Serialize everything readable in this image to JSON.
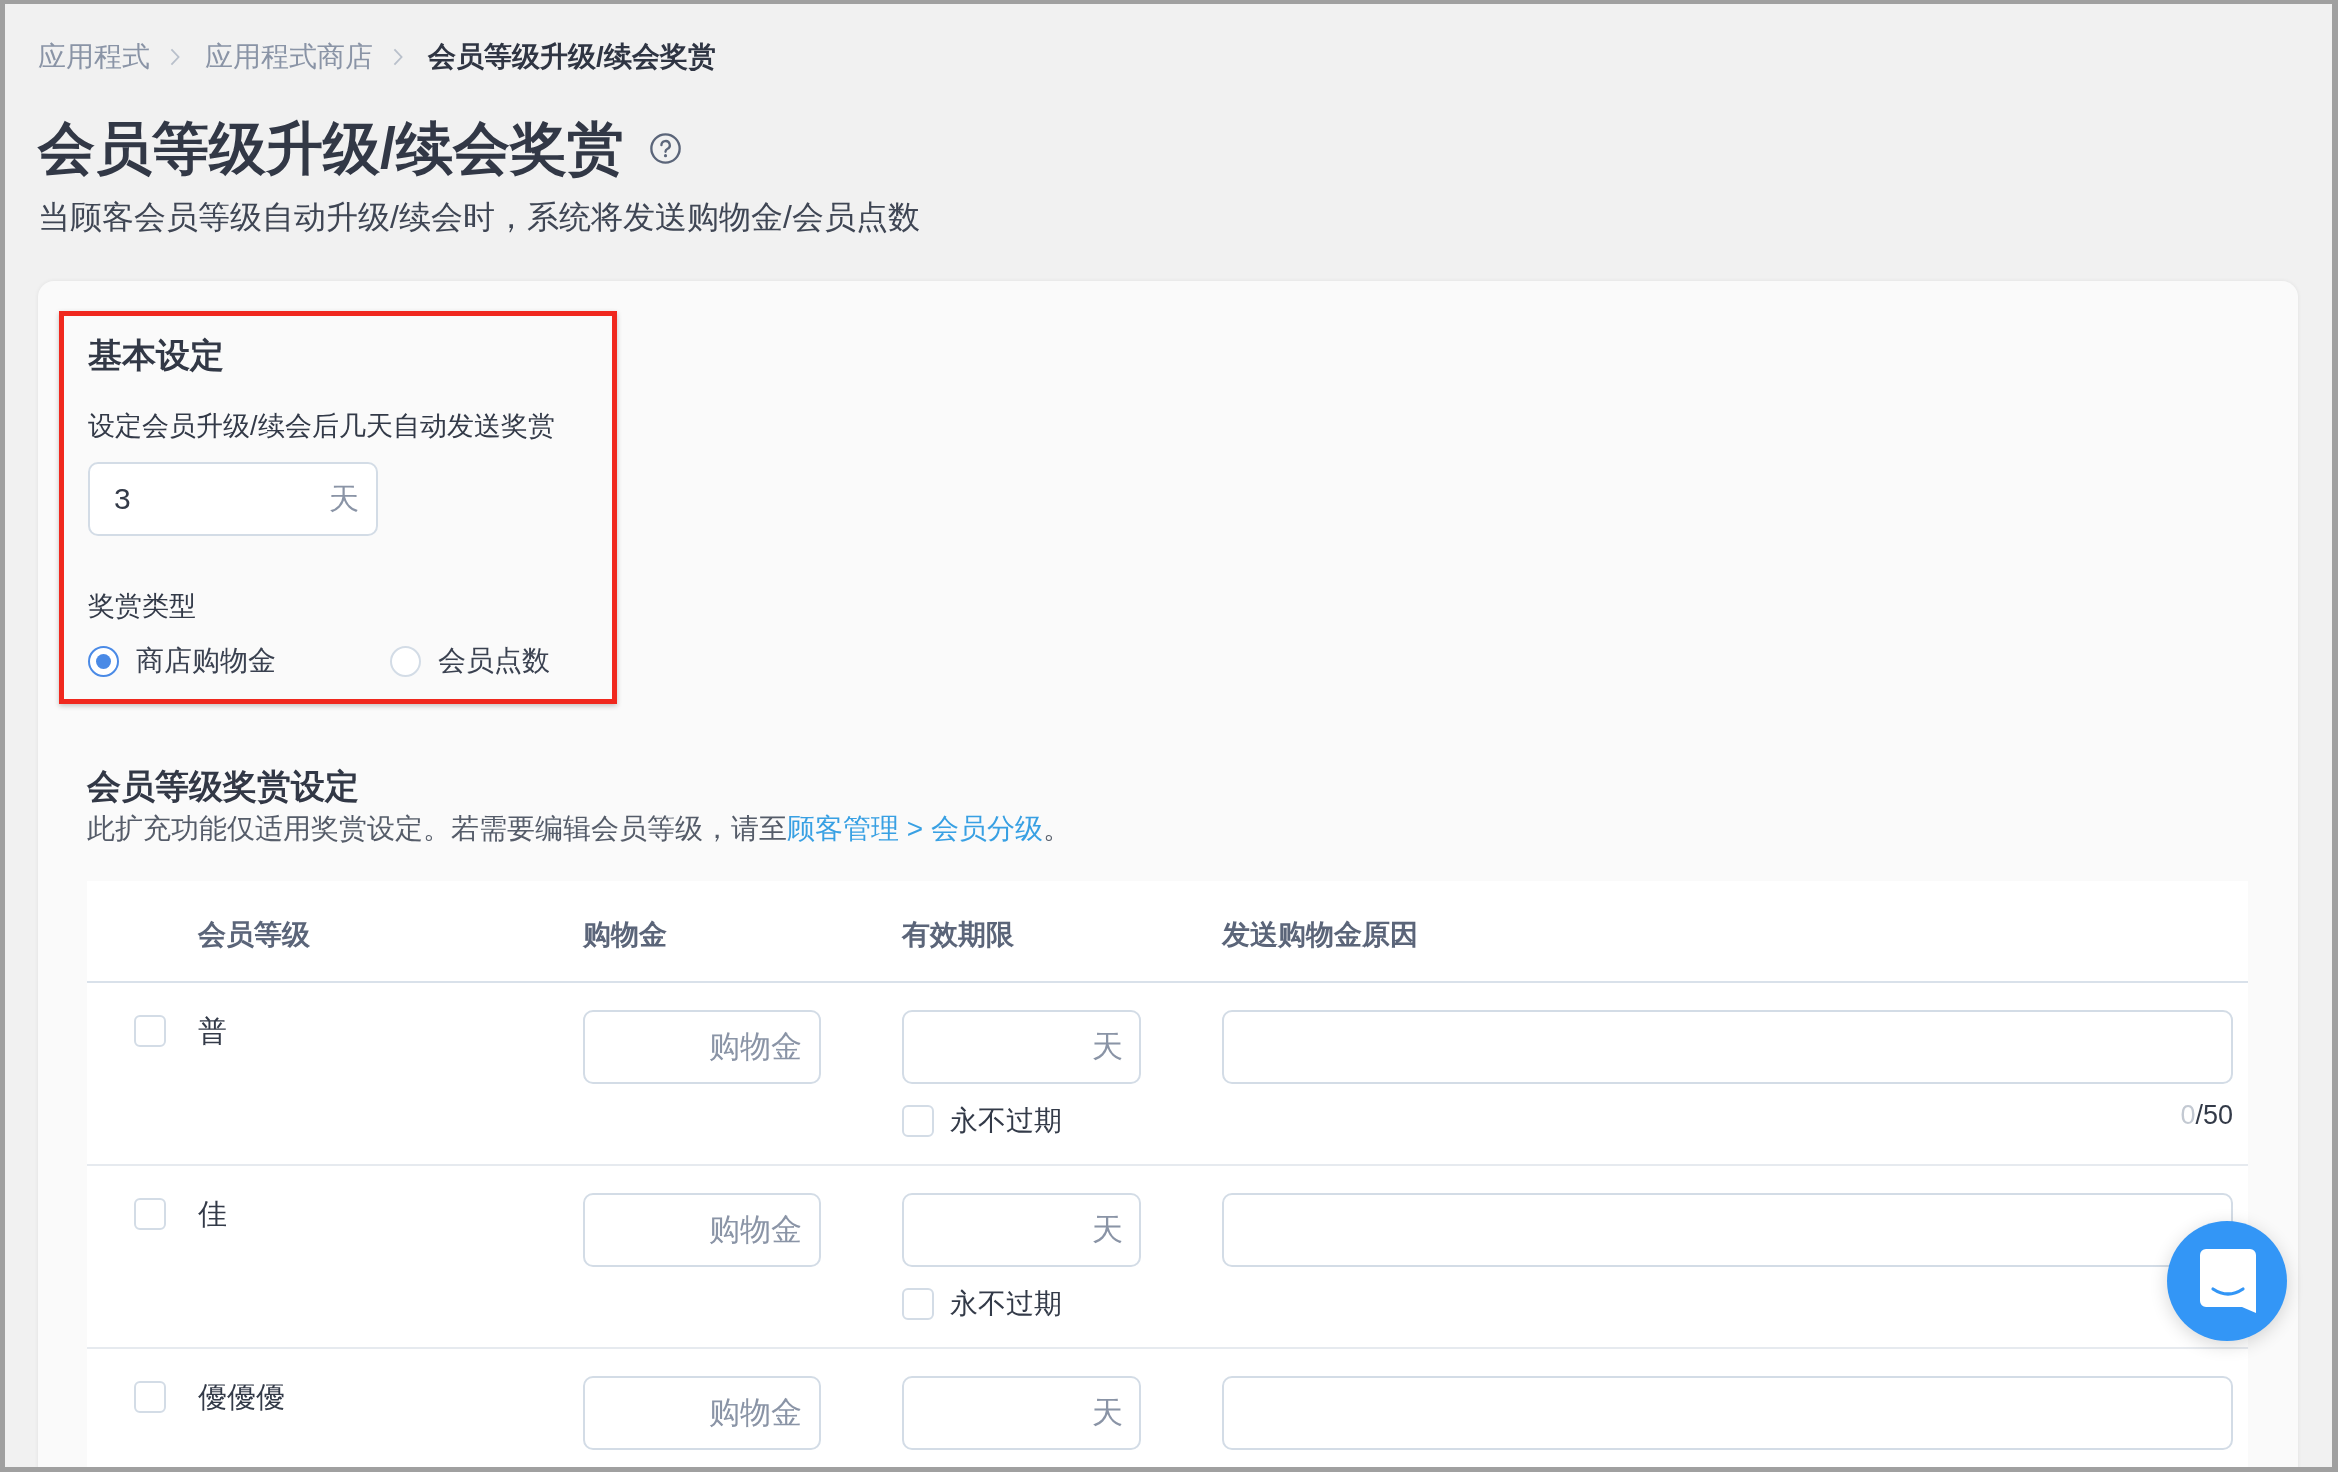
{
  "breadcrumb": [
    {
      "label": "应用程式",
      "current": false
    },
    {
      "label": "应用程式商店",
      "current": false
    },
    {
      "label": "会员等级升级/续会奖赏",
      "current": true
    }
  ],
  "page": {
    "title": "会员等级升级/续会奖赏",
    "subtitle": "当顾客会员等级自动升级/续会时，系统将发送购物金/会员点数"
  },
  "basic_settings": {
    "highlighted": true,
    "heading": "基本设定",
    "delay_label": "设定会员升级/续会后几天自动发送奖赏",
    "delay_value": "3",
    "delay_unit": "天",
    "reward_type_label": "奖赏类型",
    "reward_types": [
      {
        "label": "商店购物金",
        "selected": true
      },
      {
        "label": "会员点数",
        "selected": false
      }
    ]
  },
  "tier_rewards": {
    "heading": "会员等级奖赏设定",
    "description": "此扩充功能仅适用奖赏设定。若需要编辑会员等级，请至",
    "link": "顾客管理 > 会员分级",
    "description_end": "。",
    "columns": [
      "会员等级",
      "购物金",
      "有效期限",
      "发送购物金原因"
    ],
    "rows": [
      {
        "level": "普",
        "selected": false,
        "cash_placeholder": "购物金",
        "days_unit": "天",
        "never_expire_label": "永不过期",
        "never_expire": false,
        "counter": {
          "count": "0",
          "limit": "/50"
        }
      },
      {
        "level": "佳",
        "selected": false,
        "cash_placeholder": "购物金",
        "days_unit": "天",
        "never_expire_label": "永不过期",
        "never_expire": false
      },
      {
        "level": "優優優",
        "selected": false,
        "cash_placeholder": "购物金",
        "days_unit": "天"
      }
    ]
  }
}
